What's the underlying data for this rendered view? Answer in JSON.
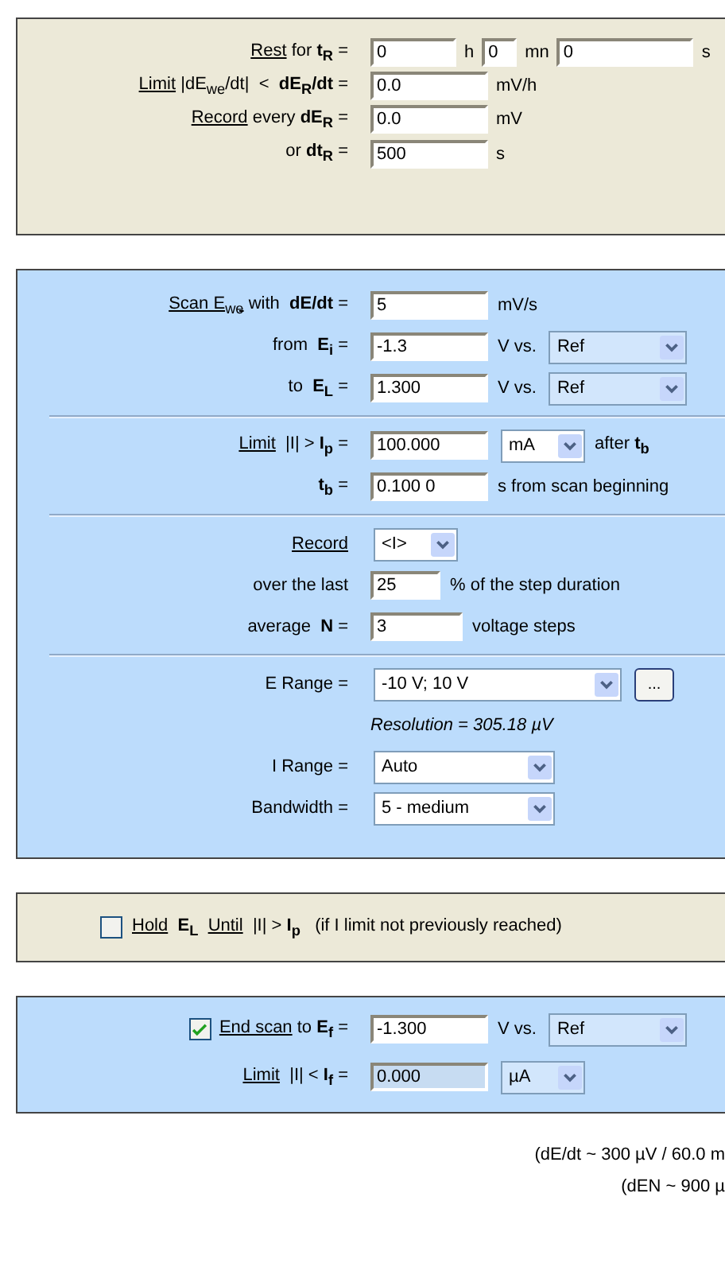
{
  "panels": [
    {
      "highlighted": false,
      "rows": [
        {
          "kind": "field",
          "label": [
            {
              "text": "Rest",
              "underline": true
            },
            {
              "text": " for **t$_{R}$** =",
              "underline": false
            }
          ],
          "controls": [
            {
              "kind": "shortinput",
              "value": "0",
              "disabled": false
            },
            {
              "kind": "unit",
              "text": "h"
            },
            {
              "kind": "tinyinput",
              "value": "0",
              "disabled": false
            },
            {
              "kind": "unit",
              "text": "mn"
            },
            {
              "kind": "wideinput",
              "value": "0",
              "disabled": false
            },
            {
              "kind": "unit",
              "text": "s"
            }
          ]
        },
        {
          "kind": "field",
          "label": [
            {
              "text": "Limit",
              "underline": true
            },
            {
              "text": " |dE$_{we}$/dt|  <  **dE$_{R}$/dt** =",
              "underline": false
            }
          ],
          "controls": [
            {
              "kind": "input",
              "value": "0.0",
              "disabled": false
            },
            {
              "kind": "unit",
              "text": "mV/h"
            }
          ]
        },
        {
          "kind": "field",
          "label": [
            {
              "text": "Record",
              "underline": true
            },
            {
              "text": " every **dE$_{R}$** =",
              "underline": false
            }
          ],
          "controls": [
            {
              "kind": "input",
              "value": "0.0",
              "disabled": false
            },
            {
              "kind": "unit",
              "text": "mV"
            }
          ]
        },
        {
          "kind": "field",
          "label": [
            {
              "text": "or **dt$_{R}$** =",
              "underline": false
            }
          ],
          "controls": [
            {
              "kind": "input",
              "value": "500",
              "disabled": false
            },
            {
              "kind": "unit",
              "text": "s"
            }
          ]
        }
      ]
    },
    {
      "highlighted": true,
      "rows": [
        {
          "kind": "field",
          "label": [
            {
              "text": "Scan E$_{we}$",
              "underline": true
            },
            {
              "text": " with  **dE/dt** =",
              "underline": false
            }
          ],
          "controls": [
            {
              "kind": "input",
              "value": "5",
              "disabled": false
            },
            {
              "kind": "unit",
              "text": "mV/s"
            }
          ]
        },
        {
          "kind": "field",
          "label": [
            {
              "text": "from  **E$_{i}$** =",
              "underline": false
            }
          ],
          "controls": [
            {
              "kind": "input",
              "value": "-1.3",
              "disabled": false
            },
            {
              "kind": "unit",
              "text": "V vs."
            },
            {
              "kind": "select",
              "value": "Ref",
              "disabled": true
            }
          ]
        },
        {
          "kind": "field",
          "label": [
            {
              "text": "to  **E$_{L}$** =",
              "underline": false
            }
          ],
          "controls": [
            {
              "kind": "input",
              "value": "1.300",
              "disabled": false
            },
            {
              "kind": "unit",
              "text": "V vs."
            },
            {
              "kind": "select",
              "value": "Ref",
              "disabled": true
            }
          ]
        },
        {
          "kind": "separator"
        },
        {
          "kind": "field",
          "label": [
            {
              "text": "Limit",
              "underline": true
            },
            {
              "text": "  |I| > **I$_{p}$** =",
              "underline": false
            }
          ],
          "controls": [
            {
              "kind": "input",
              "value": "100.000",
              "disabled": false
            },
            {
              "kind": "smallselect",
              "value": "mA",
              "disabled": false
            },
            {
              "kind": "unit",
              "text": "after **t$_{b}$**"
            }
          ]
        },
        {
          "kind": "field",
          "label": [
            {
              "text": "**t$_{b}$** =",
              "underline": false
            }
          ],
          "controls": [
            {
              "kind": "input",
              "value": "0.100 0",
              "disabled": false
            },
            {
              "kind": "unit",
              "text": "s  from scan beginning"
            }
          ]
        },
        {
          "kind": "separator"
        },
        {
          "kind": "field",
          "label": [
            {
              "text": "Record",
              "underline": true
            }
          ],
          "controls": [
            {
              "kind": "smallselect",
              "value": "<I>",
              "disabled": false
            }
          ]
        },
        {
          "kind": "field",
          "label": [
            {
              "text": "over the last",
              "underline": false
            }
          ],
          "controls": [
            {
              "kind": "tinyinput",
              "value": "25",
              "disabled": false
            },
            {
              "kind": "unit",
              "text": "% of the step duration"
            }
          ]
        },
        {
          "kind": "field",
          "label": [
            {
              "text": "average  **N** =",
              "underline": false
            }
          ],
          "controls": [
            {
              "kind": "shortinput",
              "value": "3",
              "disabled": false
            },
            {
              "kind": "unit",
              "text": "voltage steps"
            }
          ]
        },
        {
          "kind": "separator"
        },
        {
          "kind": "field",
          "label": [
            {
              "text": "E Range =",
              "underline": false
            }
          ],
          "controls": [
            {
              "kind": "wideselect",
              "value": "-10 V; 10 V",
              "disabled": false
            },
            {
              "kind": "button",
              "text": "..."
            }
          ]
        },
        {
          "kind": "note",
          "text": "Resolution = 305.18 µV"
        },
        {
          "kind": "field",
          "label": [
            {
              "text": "I Range =",
              "underline": false
            }
          ],
          "controls": [
            {
              "kind": "mediumselect",
              "value": "Auto",
              "disabled": false
            }
          ]
        },
        {
          "kind": "field",
          "label": [
            {
              "text": "Bandwidth =",
              "underline": false
            }
          ],
          "controls": [
            {
              "kind": "mediumselect",
              "value": "5 - medium",
              "disabled": false
            }
          ]
        }
      ]
    },
    {
      "highlighted": false,
      "rows": [
        {
          "kind": "check",
          "checked": false,
          "label": [
            {
              "text": "Hold",
              "underline": true
            },
            {
              "text": "  **E$_{L}$**  ",
              "underline": false
            },
            {
              "text": "Until",
              "underline": true
            },
            {
              "text": "  |I| > **I$_{p}$**   (if I limit not previously reached)",
              "underline": false
            }
          ]
        }
      ]
    },
    {
      "highlighted": true,
      "rows": [
        {
          "kind": "field",
          "checkbox": {
            "checked": true
          },
          "label": [
            {
              "text": "End scan",
              "underline": true
            },
            {
              "text": " to **E$_{f}$** =",
              "underline": false
            }
          ],
          "controls": [
            {
              "kind": "input",
              "value": "-1.300",
              "disabled": false
            },
            {
              "kind": "unit",
              "text": "V vs."
            },
            {
              "kind": "select",
              "value": "Ref",
              "disabled": true
            }
          ]
        },
        {
          "kind": "field",
          "label": [
            {
              "text": "Limit",
              "underline": true
            },
            {
              "text": "  |I| < **I$_{f}$** =",
              "underline": false
            }
          ],
          "controls": [
            {
              "kind": "input",
              "value": "0.000",
              "disabled": true
            },
            {
              "kind": "smallselect",
              "value": "µA",
              "disabled": true
            }
          ]
        }
      ]
    }
  ],
  "notes": [
    "(dE/dt ~ 300 µV / 60.0 m",
    "(dEN ~ 900 µ"
  ]
}
